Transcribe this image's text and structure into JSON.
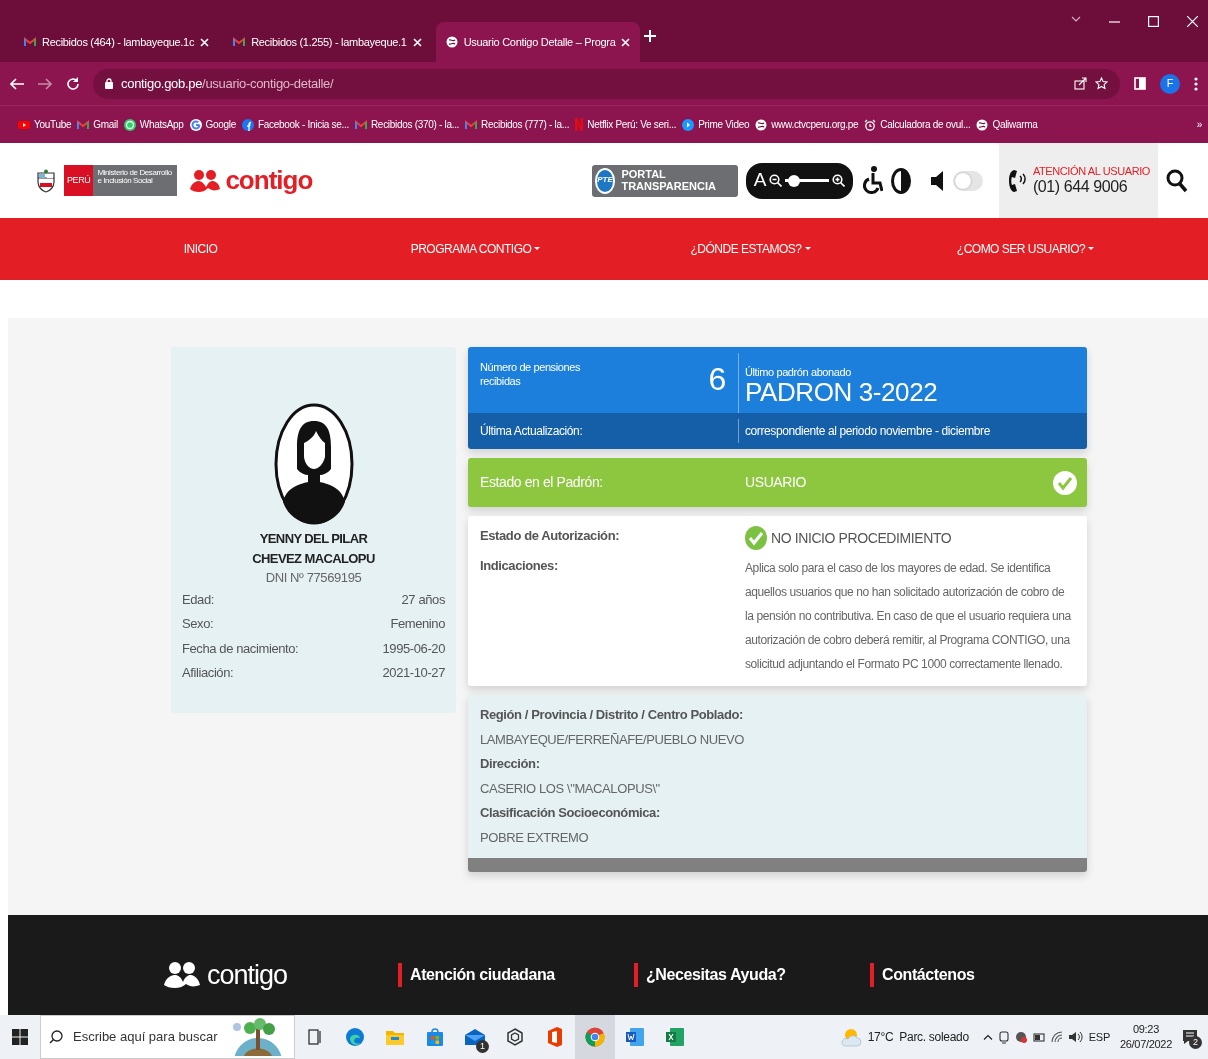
{
  "browser": {
    "tabs": [
      {
        "title": "Recibidos (464) - lambayeque.1c",
        "kind": "gmail",
        "selected": false
      },
      {
        "title": "Recibidos (1.255) - lambayeque.1",
        "kind": "gmail",
        "selected": false
      },
      {
        "title": "Usuario Contigo Detalle – Progra",
        "kind": "globe",
        "selected": true
      }
    ],
    "address": {
      "domain": "contigo.gob.pe",
      "path": "/usuario-contigo-detalle/"
    },
    "profile_initial": "F",
    "bookmarks": [
      {
        "label": "YouTube",
        "kind": "youtube"
      },
      {
        "label": "Gmail",
        "kind": "gmail"
      },
      {
        "label": "WhatsApp",
        "kind": "whatsapp"
      },
      {
        "label": "Google",
        "kind": "google"
      },
      {
        "label": "Facebook - Inicia se...",
        "kind": "facebook"
      },
      {
        "label": "Recibidos (370) - la...",
        "kind": "gmail"
      },
      {
        "label": "Recibidos (777) - la...",
        "kind": "gmail"
      },
      {
        "label": "Netflix Perú: Ve seri...",
        "kind": "netflix"
      },
      {
        "label": "Prime Video",
        "kind": "prime"
      },
      {
        "label": "www.ctvcperu.org.pe",
        "kind": "globe"
      },
      {
        "label": "Calculadora de ovul...",
        "kind": "alarm"
      },
      {
        "label": "Qaliwarma",
        "kind": "globe"
      }
    ],
    "overflow": "»"
  },
  "site": {
    "header": {
      "country": "PERÚ",
      "ministry": "Ministerio de Desarrollo e Inclusión Social",
      "brand": "contigo",
      "portal_badge": "PTE",
      "portal": "PORTAL TRANSPARENCIA",
      "zoom_label": "A",
      "zoom": {
        "level": 0.1
      },
      "sound_toggle": {
        "on": false
      },
      "support_title": "ATENCIÓN AL USUARIO",
      "support_phone": "(01) 644 9006"
    },
    "nav": [
      {
        "label": "INICIO",
        "dropdown": false
      },
      {
        "label": "PROGRAMA CONTIGO",
        "dropdown": true
      },
      {
        "label": "¿DÓNDE ESTAMOS?",
        "dropdown": true
      },
      {
        "label": "¿COMO SER USUARIO?",
        "dropdown": true
      }
    ],
    "profile": {
      "name": "YENNY DEL PILAR CHEVEZ MACALOPU",
      "dni": "DNI Nº 77569195",
      "fields": [
        {
          "label": "Edad:",
          "value": "27 años"
        },
        {
          "label": "Sexo:",
          "value": "Femenino"
        },
        {
          "label": "Fecha de nacimiento:",
          "value": "1995-06-20"
        },
        {
          "label": "Afiliación:",
          "value": "2021-10-27"
        }
      ]
    },
    "summary": {
      "pensions_label": "Número de pensiones recibidas",
      "pensions": "6",
      "last_padron_label": "Último padrón abonado",
      "last_padron": "PADRON 3-2022",
      "update_label": "Última Actualización:",
      "update_value": "correspondiente al periodo noviembre - diciembre"
    },
    "padron_status": {
      "label": "Estado en el Padrón:",
      "value": "USUARIO",
      "checked": true
    },
    "authorization": {
      "status_label": "Estado de Autorización:",
      "status": "NO INICIO PROCEDIMIENTO",
      "indications_label": "Indicaciones:",
      "indications": "Aplica solo para el caso de los mayores de edad. Se identifica aquellos usuarios que no han solicitado autorización de cobro de la pensión no contributiva. En caso de que el usuario requiera una autorización de cobro deberá remitir, al Programa CONTIGO, una solicitud adjuntando el Formato PC 1000 correctamente llenado."
    },
    "location": [
      {
        "label": "Región / Provincia / Distrito / Centro Poblado:",
        "value": "LAMBAYEQUE/FERREÑAFE/PUEBLO NUEVO"
      },
      {
        "label": "Dirección:",
        "value": "CASERIO LOS \\\"MACALOPUS\\\""
      },
      {
        "label": "Clasificación Socioeconómica:",
        "value": "POBRE EXTREMO"
      }
    ],
    "footer": {
      "brand": "contigo",
      "links": [
        "Atención ciudadana",
        "¿Necesitas Ayuda?",
        "Contáctenos"
      ]
    }
  },
  "taskbar": {
    "search_placeholder": "Escribe aquí para buscar",
    "apps": [
      {
        "kind": "taskview",
        "selected": false
      },
      {
        "kind": "edge",
        "selected": false
      },
      {
        "kind": "explorer",
        "selected": false
      },
      {
        "kind": "store",
        "selected": false
      },
      {
        "kind": "mail",
        "selected": false,
        "badge": "1"
      },
      {
        "kind": "hex",
        "selected": false
      },
      {
        "kind": "office",
        "selected": false
      },
      {
        "kind": "chrome",
        "selected": true
      },
      {
        "kind": "word",
        "selected": false
      },
      {
        "kind": "excel",
        "selected": false
      }
    ],
    "weather": {
      "temp": "17°C",
      "condition": "Parc. soleado"
    },
    "language": "ESP",
    "time": "09:23",
    "date": "26/07/2022",
    "notifications": "2"
  }
}
